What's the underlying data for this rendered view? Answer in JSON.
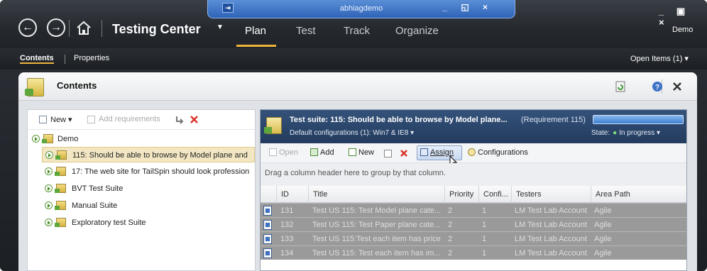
{
  "window": {
    "title": "abhiagdemo",
    "controls": "_ ◱ ×",
    "controls_main": "_ ▣ ×"
  },
  "app": {
    "title": "Testing Center",
    "user": "Demo"
  },
  "tabs": [
    {
      "label": "Plan"
    },
    {
      "label": "Test"
    },
    {
      "label": "Track"
    },
    {
      "label": "Organize"
    }
  ],
  "subnav": {
    "contents": "Contents",
    "properties": "Properties",
    "open_items": "Open Items (1) ▾"
  },
  "panel": {
    "title": "Contents"
  },
  "left_toolbar": {
    "new": "New ▾",
    "add_requirements": "Add requirements"
  },
  "tree": [
    {
      "label": "Demo",
      "level": 0
    },
    {
      "label": "115: Should be able to browse by Model plane and",
      "level": 1,
      "selected": true
    },
    {
      "label": "17: The web site for TailSpin should look profession",
      "level": 1
    },
    {
      "label": "BVT Test Suite",
      "level": 1
    },
    {
      "label": "Manual Suite",
      "level": 1
    },
    {
      "label": "Exploratory test Suite",
      "level": 1
    }
  ],
  "suite": {
    "title": "Test suite:  115: Should be able to browse by Model plane...",
    "requirement": "(Requirement 115)",
    "configurations": "Default configurations (1): Win7 & IE8 ▾",
    "state_label": "State:",
    "state_value": "In progress ▾",
    "state_color": "#7fe07a",
    "progress": 1.0
  },
  "right_toolbar": {
    "open": "Open",
    "add": "Add",
    "new": "New",
    "assign": "Assign",
    "configurations": "Configurations"
  },
  "group_hint": "Drag a column header here to group by that column.",
  "columns": [
    "ID",
    "Title",
    "Priority",
    "Confi...",
    "Testers",
    "Area Path"
  ],
  "rows": [
    {
      "id": "131",
      "title": "Test US 115: Test Model plane cate...",
      "priority": "2",
      "config": "1",
      "testers": "LM Test Lab Account",
      "area": "Agile"
    },
    {
      "id": "132",
      "title": "Test US 115: Test Paper plane cate...",
      "priority": "2",
      "config": "1",
      "testers": "LM Test Lab Account",
      "area": "Agile"
    },
    {
      "id": "133",
      "title": "Test US 115:Test each item has price",
      "priority": "2",
      "config": "1",
      "testers": "LM Test Lab Account",
      "area": "Agile"
    },
    {
      "id": "134",
      "title": "Test US 115: Test each item has im...",
      "priority": "2",
      "config": "1",
      "testers": "LM Test Lab Account",
      "area": "Agile"
    }
  ]
}
